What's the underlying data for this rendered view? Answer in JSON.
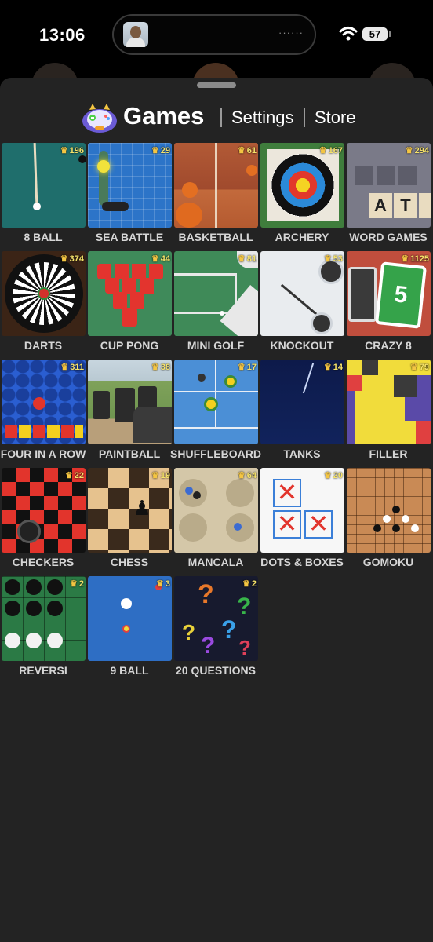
{
  "status_bar": {
    "time": "13:06",
    "island_dots": "······",
    "battery": "57"
  },
  "header": {
    "title": "Games",
    "nav_settings": "Settings",
    "nav_store": "Store"
  },
  "games": [
    {
      "name": "8 BALL",
      "count": "196",
      "icon": "8ball-icon"
    },
    {
      "name": "SEA BATTLE",
      "count": "29",
      "icon": "sea-battle-icon"
    },
    {
      "name": "BASKETBALL",
      "count": "61",
      "icon": "basketball-icon"
    },
    {
      "name": "ARCHERY",
      "count": "167",
      "icon": "archery-icon"
    },
    {
      "name": "WORD GAMES",
      "count": "294",
      "icon": "word-games-icon"
    },
    {
      "name": "DARTS",
      "count": "374",
      "icon": "darts-icon"
    },
    {
      "name": "CUP PONG",
      "count": "44",
      "icon": "cup-pong-icon"
    },
    {
      "name": "MINI GOLF",
      "count": "81",
      "icon": "mini-golf-icon"
    },
    {
      "name": "KNOCKOUT",
      "count": "53",
      "icon": "knockout-icon"
    },
    {
      "name": "CRAZY 8",
      "count": "1125",
      "icon": "crazy8-icon"
    },
    {
      "name": "FOUR IN A ROW",
      "count": "311",
      "icon": "four-in-a-row-icon"
    },
    {
      "name": "PAINTBALL",
      "count": "38",
      "icon": "paintball-icon"
    },
    {
      "name": "SHUFFLEBOARD",
      "count": "17",
      "icon": "shuffleboard-icon"
    },
    {
      "name": "TANKS",
      "count": "14",
      "icon": "tanks-icon"
    },
    {
      "name": "FILLER",
      "count": "79",
      "icon": "filler-icon"
    },
    {
      "name": "CHECKERS",
      "count": "22",
      "icon": "checkers-icon"
    },
    {
      "name": "CHESS",
      "count": "19",
      "icon": "chess-icon"
    },
    {
      "name": "MANCALA",
      "count": "64",
      "icon": "mancala-icon"
    },
    {
      "name": "DOTS & BOXES",
      "count": "20",
      "icon": "dots-and-boxes-icon"
    },
    {
      "name": "GOMOKU",
      "count": "",
      "icon": "gomoku-icon"
    },
    {
      "name": "REVERSI",
      "count": "2",
      "icon": "reversi-icon"
    },
    {
      "name": "9 BALL",
      "count": "3",
      "icon": "9ball-icon"
    },
    {
      "name": "20 QUESTIONS",
      "count": "2",
      "icon": "20-questions-icon"
    }
  ],
  "colors": {
    "sheet_bg": "#232323",
    "badge": "#f6e36a",
    "label": "#d6d6d6"
  }
}
